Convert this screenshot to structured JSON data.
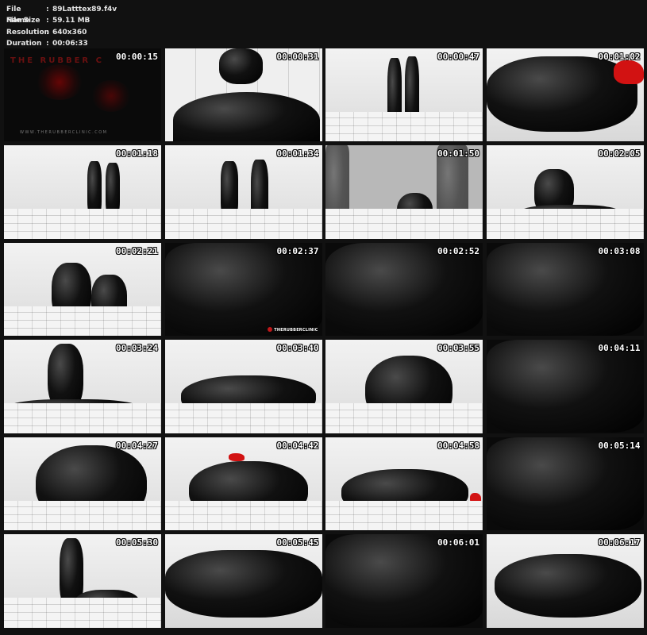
{
  "file_info": [
    {
      "key": "File Name",
      "value": "89Latttex89.f4v"
    },
    {
      "key": "File Size",
      "value": "59.11 MB"
    },
    {
      "key": "Resolution",
      "value": "640x360"
    },
    {
      "key": "Duration",
      "value": "00:06:33"
    }
  ],
  "separator": ":",
  "intro": {
    "title": "THE RUBBER C",
    "url": "WWW.THERUBBERCLINIC.COM"
  },
  "watermark": "THERUBBERCLINIC",
  "thumbnails": [
    {
      "time": "00:00:15"
    },
    {
      "time": "00:00:31"
    },
    {
      "time": "00:00:47"
    },
    {
      "time": "00:01:02"
    },
    {
      "time": "00:01:18"
    },
    {
      "time": "00:01:34"
    },
    {
      "time": "00:01:50"
    },
    {
      "time": "00:02:05"
    },
    {
      "time": "00:02:21"
    },
    {
      "time": "00:02:37"
    },
    {
      "time": "00:02:52"
    },
    {
      "time": "00:03:08"
    },
    {
      "time": "00:03:24"
    },
    {
      "time": "00:03:40"
    },
    {
      "time": "00:03:55"
    },
    {
      "time": "00:04:11"
    },
    {
      "time": "00:04:27"
    },
    {
      "time": "00:04:42"
    },
    {
      "time": "00:04:58"
    },
    {
      "time": "00:05:14"
    },
    {
      "time": "00:05:30"
    },
    {
      "time": "00:05:45"
    },
    {
      "time": "00:06:01"
    },
    {
      "time": "00:06:17"
    }
  ]
}
